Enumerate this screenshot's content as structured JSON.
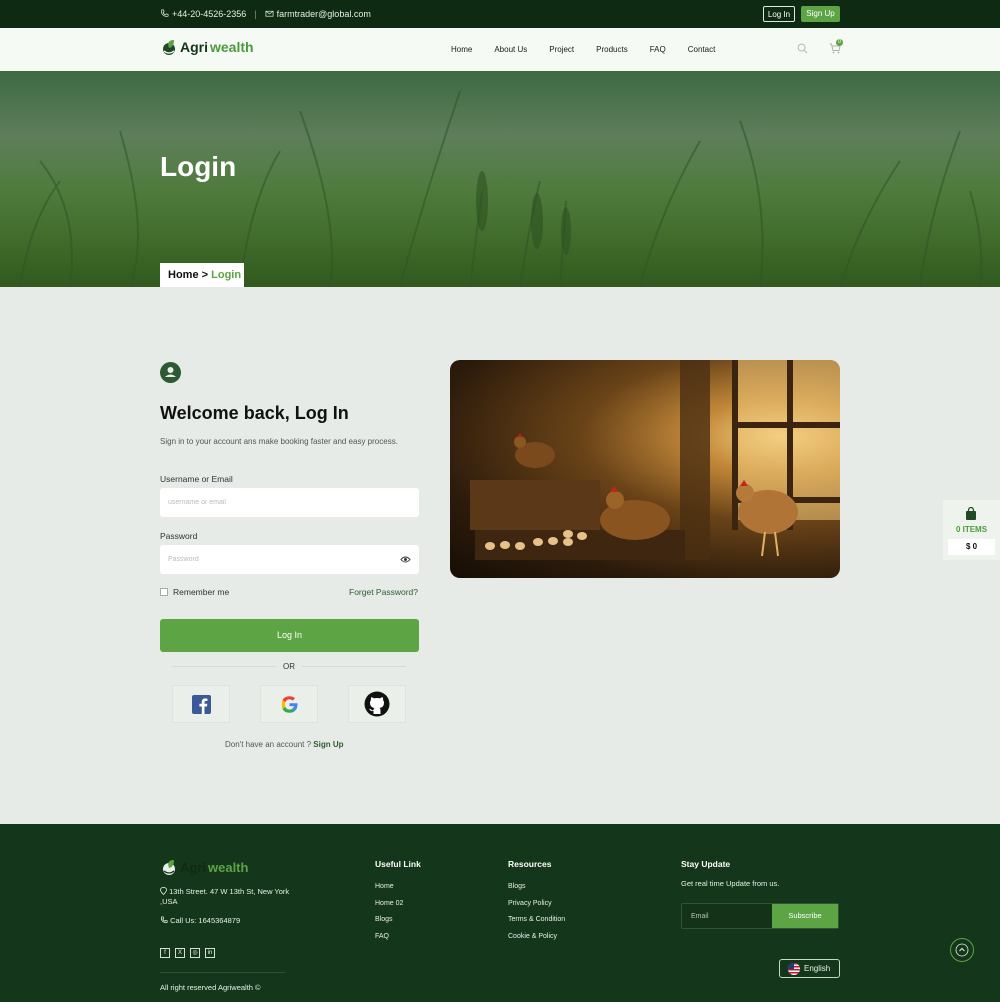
{
  "topbar": {
    "phone": "+44-20-4526-2356",
    "email": "farmtrader@global.com",
    "login_label": "Log In",
    "signup_label": "Sign Up"
  },
  "nav": {
    "logo_part1": "Agri",
    "logo_part2": "wealth",
    "links": [
      "Home",
      "About Us",
      "Project",
      "Products",
      "FAQ",
      "Contact"
    ],
    "cart_count": "0"
  },
  "hero": {
    "title": "Login",
    "breadcrumb_home": "Home",
    "breadcrumb_sep": ">",
    "breadcrumb_current": "Login"
  },
  "form": {
    "heading": "Welcome back, Log In",
    "subtext": "Sign in to your account ans make booking faster and easy process.",
    "username_label": "Username or Email",
    "username_placeholder": "username or email",
    "password_label": "Password",
    "password_placeholder": "Password",
    "remember_label": "Remember me",
    "forget_label": "Forget Password?",
    "login_button": "Log In",
    "or_label": "OR",
    "signup_prompt": "Don't have an account ?",
    "signup_link": "Sign Up"
  },
  "side_cart": {
    "items_label": "0 ITEMS",
    "price": "$ 0"
  },
  "footer": {
    "logo_part1": "Agri",
    "logo_part2": "wealth",
    "address": "13th Street. 47 W 13th St, New York ,USA",
    "call_label": "Call Us: 1645364879",
    "copyright": "All right reserved Agriwealth ©",
    "useful_title": "Useful Link",
    "useful_links": [
      "Home",
      "Home 02",
      "Blogs",
      "FAQ"
    ],
    "resources_title": "Resources",
    "resources_links": [
      "Blogs",
      "Privacy Policy",
      "Terms & Condition",
      "Cookie & Policy"
    ],
    "stay_title": "Stay Update",
    "stay_text": "Get real time Update from us.",
    "email_placeholder": "Email",
    "subscribe_label": "Subscribe",
    "language": "English"
  },
  "colors": {
    "brand_green": "#5da445",
    "dark_green": "#14361a",
    "page_bg": "#e6ebe7"
  }
}
